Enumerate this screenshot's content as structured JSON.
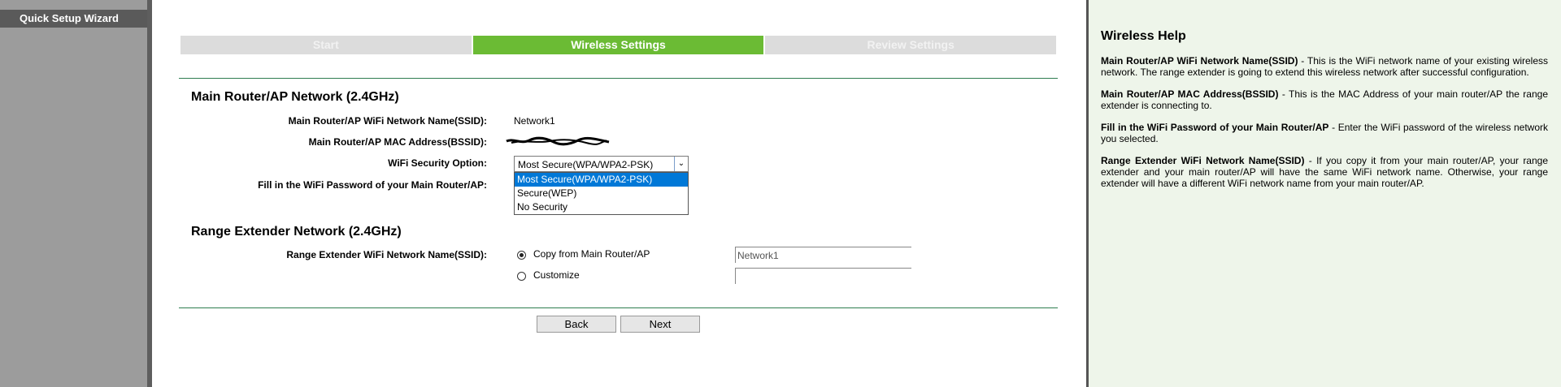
{
  "sidebar": {
    "items": [
      {
        "label": "Quick Setup Wizard"
      }
    ]
  },
  "steps": [
    {
      "label": "Start"
    },
    {
      "label": "Wireless Settings"
    },
    {
      "label": "Review Settings"
    }
  ],
  "main_network": {
    "title": "Main Router/AP Network  (2.4GHz)",
    "ssid_label": "Main Router/AP WiFi Network Name(SSID):",
    "ssid_value": "Network1",
    "mac_label": "Main Router/AP MAC Address(BSSID):",
    "security_label": "WiFi Security Option:",
    "security_selected": "Most Secure(WPA/WPA2-PSK)",
    "security_options": [
      "Most Secure(WPA/WPA2-PSK)",
      "Secure(WEP)",
      "No Security"
    ],
    "password_label": "Fill in the WiFi Password of your Main Router/AP:"
  },
  "extender_network": {
    "title": "Range Extender Network  (2.4GHz)",
    "ssid_label": "Range Extender WiFi Network Name(SSID):",
    "option_copy": "Copy from Main Router/AP",
    "option_customize": "Customize",
    "copy_value": "Network1",
    "customize_value": ""
  },
  "buttons": {
    "back": "Back",
    "next": "Next"
  },
  "help": {
    "title": "Wireless Help",
    "entries": [
      {
        "term": "Main Router/AP WiFi Network Name(SSID)",
        "text": " - This is the WiFi network name of your existing wireless network. The range extender is going to extend this wireless network after successful configuration."
      },
      {
        "term": "Main Router/AP MAC Address(BSSID)",
        "text": " - This is the MAC Address of your main router/AP the range extender is connecting to."
      },
      {
        "term": "Fill in the WiFi Password of your Main Router/AP",
        "text": " - Enter the WiFi password of the wireless network you selected."
      },
      {
        "term": "Range Extender WiFi Network Name(SSID)",
        "text": " - If you copy it from your main router/AP, your range extender and your main router/AP will have the same WiFi network name. Otherwise, your range extender will have a different WiFi network name from your main router/AP."
      }
    ]
  }
}
